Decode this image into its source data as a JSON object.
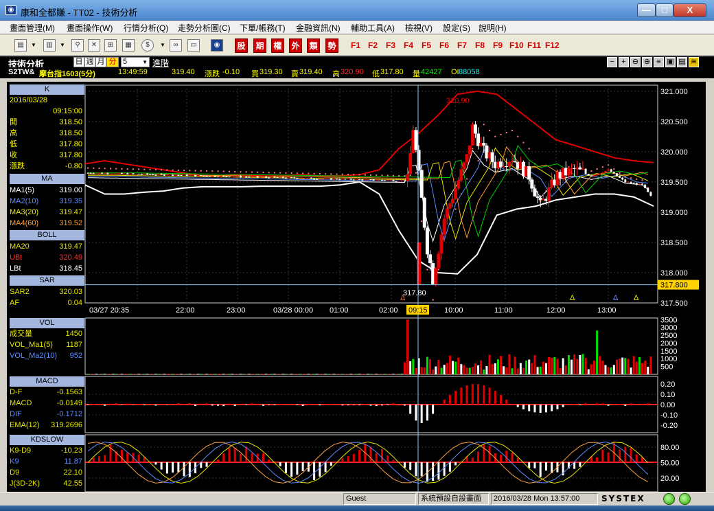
{
  "window": {
    "title": "康和全都賺 - TT02 - 技術分析",
    "min": "—",
    "max": "□",
    "close": "X"
  },
  "menu": [
    "畫面管理(M)",
    "畫面操作(W)",
    "行情分析(Q)",
    "走勢分析圖(C)",
    "下單/帳務(T)",
    "金融資訊(N)",
    "輔助工具(A)",
    "檢視(V)",
    "設定(S)",
    "說明(H)"
  ],
  "toolbar": {
    "category_buttons": [
      "股",
      "期",
      "權",
      "外",
      "類",
      "勢"
    ],
    "fkeys": [
      "F1",
      "F2",
      "F3",
      "F4",
      "F5",
      "F6",
      "F7",
      "F8",
      "F9",
      "F10",
      "F11",
      "F12"
    ],
    "icons": [
      "layout-icon",
      "chart-icon",
      "search-icon",
      "cancel-icon",
      "grid-icon",
      "calc-icon",
      "coin-icon",
      "link-icon",
      "window-icon",
      "logo-icon"
    ]
  },
  "control": {
    "panel_title": "技術分析",
    "periods": [
      "日",
      "週",
      "月",
      "分"
    ],
    "selected_period": "分",
    "period_value": "5",
    "advanced": "進階",
    "right_tools": [
      "−",
      "+",
      "⊖",
      "⊕",
      "≡",
      "▣",
      "▤",
      "≋"
    ]
  },
  "quote": {
    "code": "S2TW&",
    "name": "摩台指1603(5分)",
    "time": "13:49:59",
    "price": "319.40",
    "change_label": "漲跌",
    "change": "-0.10",
    "bid_label": "買",
    "bid": "319.30",
    "ask_label": "賣",
    "ask": "319.40",
    "high_label": "高",
    "high": "320.90",
    "low_label": "低",
    "low": "317.80",
    "vol_label": "量",
    "vol": "42427",
    "oi_label": "OI",
    "oi": "88058"
  },
  "left_panel": {
    "k": {
      "header": "K",
      "date": "2016/03/28",
      "time": "09:15:00",
      "rows": [
        {
          "label": "開",
          "value": "318.50"
        },
        {
          "label": "高",
          "value": "318.50"
        },
        {
          "label": "低",
          "value": "317.80"
        },
        {
          "label": "收",
          "value": "317.80"
        },
        {
          "label": "漲跌",
          "value": "-0.80"
        }
      ]
    },
    "ma": {
      "header": "MA",
      "rows": [
        {
          "label": "MA1(5)",
          "value": "319.00",
          "color": "#ffffff"
        },
        {
          "label": "MA2(10)",
          "value": "319.35",
          "color": "#5b8cff"
        },
        {
          "label": "MA3(20)",
          "value": "319.47",
          "color": "#e6e600"
        },
        {
          "label": "MA4(60)",
          "value": "319.52",
          "color": "#ff9a2e"
        }
      ]
    },
    "boll": {
      "header": "BOLL",
      "rows": [
        {
          "label": "MA20",
          "value": "319.47",
          "color": "#e6e600"
        },
        {
          "label": "UBt",
          "value": "320.49",
          "color": "#ff3030"
        },
        {
          "label": "LBt",
          "value": "318.45",
          "color": "#ffffff"
        }
      ]
    },
    "sar": {
      "header": "SAR",
      "rows": [
        {
          "label": "SAR2",
          "value": "320.03",
          "color": "#e6e600"
        },
        {
          "label": "AF",
          "value": "0.04",
          "color": "#e6e600"
        }
      ]
    },
    "vol": {
      "header": "VOL",
      "rows": [
        {
          "label": "成交量",
          "value": "1450",
          "color": "#e6e600"
        },
        {
          "label": "VOL_Ma1(5)",
          "value": "1187",
          "color": "#e6e600"
        },
        {
          "label": "VOL_Ma2(10)",
          "value": "952",
          "color": "#5b8cff"
        }
      ]
    },
    "macd": {
      "header": "MACD",
      "rows": [
        {
          "label": "D-F",
          "value": "-0.1563",
          "color": "#e6e600"
        },
        {
          "label": "MACD",
          "value": "-0.0149",
          "color": "#e6e600"
        },
        {
          "label": "DIF",
          "value": "-0.1712",
          "color": "#5b8cff"
        },
        {
          "label": "EMA(12)",
          "value": "319.2696",
          "color": "#e6e600"
        }
      ]
    },
    "kd": {
      "header": "KDSLOW",
      "rows": [
        {
          "label": "K9-D9",
          "value": "-10.23",
          "color": "#e6e600"
        },
        {
          "label": "K9",
          "value": "11.87",
          "color": "#5b8cff"
        },
        {
          "label": "D9",
          "value": "22.10",
          "color": "#e6e600"
        },
        {
          "label": "J(3D-2K)",
          "value": "42.55",
          "color": "#e6e600"
        }
      ]
    }
  },
  "chart_data": [
    {
      "type": "candlestick",
      "title": "",
      "price_axis": [
        "321.000",
        "320.500",
        "320.000",
        "319.500",
        "319.000",
        "318.500",
        "318.000",
        "317.500"
      ],
      "price_range": [
        317.5,
        321.1
      ],
      "time_axis": [
        "03/27 20:35",
        "22:00",
        "23:00",
        "03/28 00:00",
        "01:00",
        "02:00",
        "09:15",
        "10:00",
        "11:00",
        "12:00",
        "13:00"
      ],
      "cursor_time": "09:15",
      "cursor_price_label": "317.800",
      "annotations": [
        {
          "text": "320.90"
        },
        {
          "text": "317.80"
        }
      ],
      "series": [
        {
          "name": "UBt",
          "color": "#e00000",
          "values": [
            319.8,
            319.85,
            319.8,
            319.75,
            319.7,
            319.65,
            319.6,
            319.6,
            319.62,
            319.6,
            319.6,
            319.62,
            319.6,
            319.6,
            319.62,
            319.7,
            320.05,
            320.3,
            320.6,
            320.95,
            321.0,
            320.95,
            320.7,
            320.45,
            320.2,
            320.1,
            320.0,
            319.9,
            319.85,
            319.82
          ]
        },
        {
          "name": "LBt",
          "color": "#ffffff",
          "values": [
            319.45,
            319.3,
            319.3,
            319.33,
            319.35,
            319.4,
            319.42,
            319.42,
            319.42,
            319.43,
            319.43,
            319.43,
            319.43,
            319.45,
            319.5,
            319.3,
            318.7,
            318.2,
            318.0,
            317.98,
            318.3,
            318.95,
            319.05,
            319.1,
            319.2,
            319.25,
            319.3,
            319.3,
            319.25,
            319.1
          ]
        }
      ]
    },
    {
      "type": "bar",
      "title": "",
      "y_axis": [
        "3500",
        "3000",
        "2500",
        "2000",
        "1500",
        "1000",
        "500"
      ],
      "y_range": [
        0,
        3600
      ]
    },
    {
      "type": "bar",
      "title": "",
      "y_axis": [
        "0.20",
        "0.10",
        "0.00",
        "-0.10",
        "-0.20"
      ],
      "y_range": [
        -0.25,
        0.25
      ]
    },
    {
      "type": "line",
      "title": "",
      "y_axis": [
        "80.00",
        "50.00",
        "20.00"
      ],
      "y_range": [
        0,
        100
      ]
    }
  ],
  "status": {
    "user": "Guest",
    "layout": "系統預設自設畫面",
    "datetime": "2016/03/28 Mon 13:57:00",
    "brand": "SYSTEX"
  }
}
